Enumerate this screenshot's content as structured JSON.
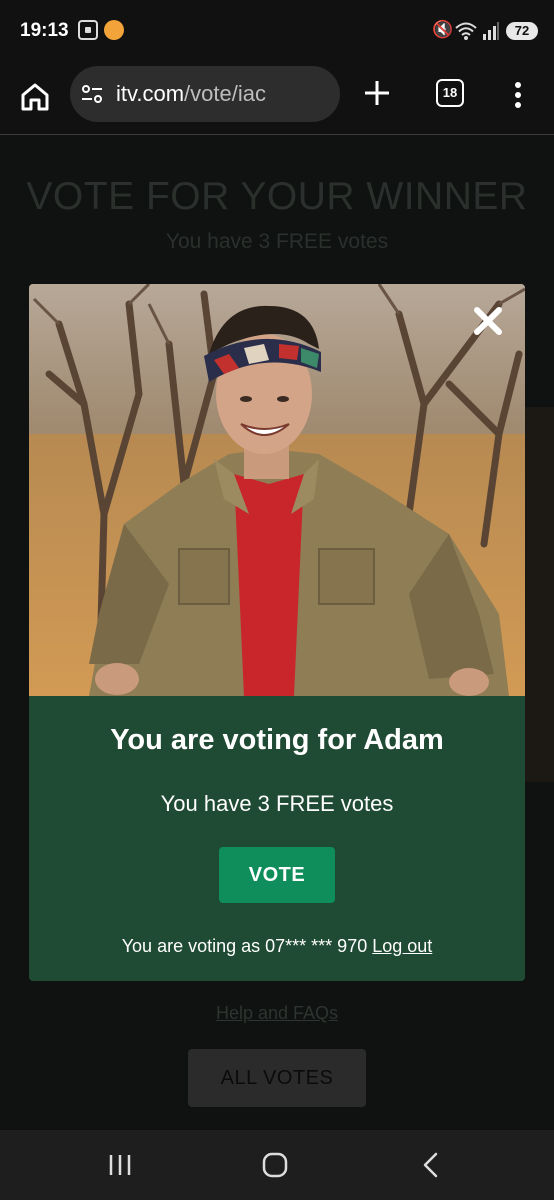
{
  "status_bar": {
    "time": "19:13",
    "battery": "72",
    "icons": [
      "screenshot-icon",
      "app-notification-icon",
      "mute-icon",
      "wifi-icon",
      "signal-icon",
      "battery-icon"
    ]
  },
  "browser": {
    "url_host": "itv.com",
    "url_path": "/vote/iac",
    "tab_count": "18"
  },
  "page": {
    "title": "VOTE FOR YOUR WINNER",
    "subtitle": "You have 3 FREE votes",
    "help_link": "Help and FAQs",
    "all_votes_button": "ALL VOTES"
  },
  "modal": {
    "heading": "You are voting for Adam",
    "free_votes": "You have 3 FREE votes",
    "vote_button": "VOTE",
    "voting_as": "You are voting as 07*** *** 970",
    "logout": "Log out",
    "colors": {
      "panel": "#1f4a33",
      "vote_button": "#0f8e5c"
    }
  },
  "nav": {
    "icons": [
      "recent-apps-icon",
      "home-icon",
      "back-icon"
    ]
  }
}
